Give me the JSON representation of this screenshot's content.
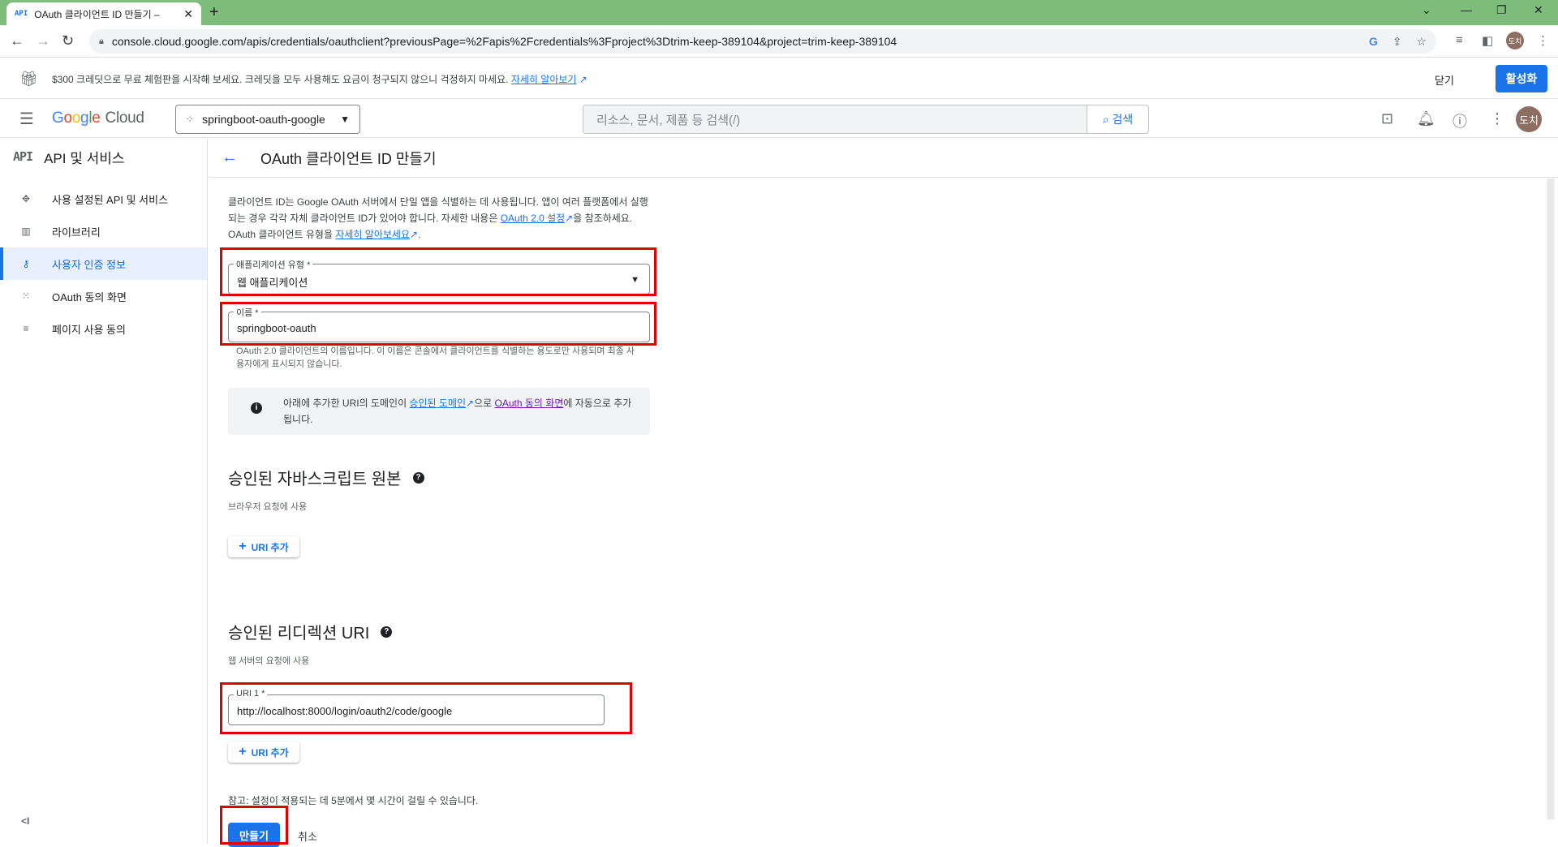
{
  "browser": {
    "tab_favicon": "API",
    "tab_title": "OAuth 클라이언트 ID 만들기 – ",
    "url": "console.cloud.google.com/apis/credentials/oauthclient?previousPage=%2Fapis%2Fcredentials%3Fproject%3Dtrim-keep-389104&project=trim-keep-389104",
    "profile_initials": "도치"
  },
  "promo": {
    "message": "$300 크레딧으로 무료 체험판을 시작해 보세요. 크레딧을 모두 사용해도 요금이 청구되지 않으니 걱정하지 마세요.",
    "link": "자세히 알아보기",
    "close_label": "닫기",
    "activate_label": "활성화"
  },
  "header": {
    "logo_google": [
      "G",
      "o",
      "o",
      "g",
      "l",
      "e"
    ],
    "logo_cloud": "Cloud",
    "project": "springboot-oauth-google",
    "search_placeholder": "리소스, 문서, 제품 등 검색(/)",
    "search_button": "검색",
    "avatar": "도치"
  },
  "sidebar": {
    "title_icon": "API",
    "title": "API 및 서비스",
    "items": [
      {
        "icon": "enabled-apis-icon",
        "label": "사용 설정된 API 및 서비스"
      },
      {
        "icon": "library-icon",
        "label": "라이브러리"
      },
      {
        "icon": "key-icon",
        "label": "사용자 인증 정보",
        "active": true
      },
      {
        "icon": "consent-screen-icon",
        "label": "OAuth 동의 화면"
      },
      {
        "icon": "page-usage-icon",
        "label": "페이지 사용 동의"
      }
    ]
  },
  "page": {
    "title": "OAuth 클라이언트 ID 만들기",
    "intro_1": "클라이언트 ID는 Google OAuth 서버에서 단일 앱을 식별하는 데 사용됩니다. 앱이 여러 플랫폼에서 실행되는 경우 각각 자체 클라이언트 ID가 있어야 합니다. 자세한 내용은 ",
    "intro_link_1": "OAuth 2.0 설정",
    "intro_2": "을 참조하세요. OAuth 클라이언트 유형을 ",
    "intro_link_2": "자세히 알아보세요",
    "intro_3": ".",
    "app_type_label": "애플리케이션 유형 *",
    "app_type_value": "웹 애플리케이션",
    "name_label": "이름 *",
    "name_value": "springboot-oauth",
    "name_hint": "OAuth 2.0 클라이언트의 이름입니다. 이 이름은 콘솔에서 클라이언트를 식별하는 용도로만 사용되며 최종 사용자에게 표시되지 않습니다.",
    "info_1": "아래에 추가한 URI의 도메인이 ",
    "info_link_1": "승인된 도메인",
    "info_2": "으로 ",
    "info_link_2": "OAuth 동의 화면",
    "info_3": "에 자동으로 추가됩니다.",
    "js_origins_title": "승인된 자바스크립트 원본",
    "js_origins_sub": "브라우저 요청에 사용",
    "add_uri": "URI 추가",
    "redirect_title": "승인된 리디렉션 URI",
    "redirect_sub": "웹 서버의 요청에 사용",
    "uri1_label": "URI 1 *",
    "uri1_value": "http://localhost:8000/login/oauth2/code/google",
    "note": "참고: 설정이 적용되는 데 5분에서 몇 시간이 걸릴 수 있습니다.",
    "create": "만들기",
    "cancel": "취소"
  },
  "colors": {
    "accent": "#1a73e8",
    "highlight": "#e00000",
    "tabstrip": "#7dbc7a"
  }
}
